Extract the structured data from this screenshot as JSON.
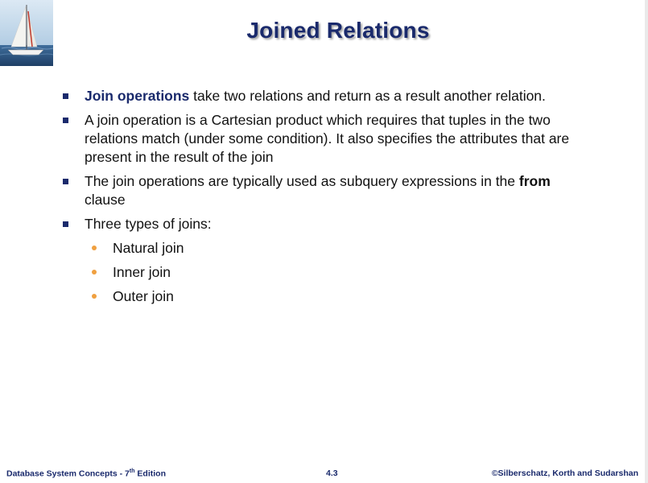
{
  "slide": {
    "title": "Joined Relations",
    "bullets": [
      {
        "lead": "Join operations",
        "text": " take two relations and return as a result another relation."
      },
      {
        "text": "A join operation is a Cartesian product which requires that tuples in the two relations match (under some condition).  It also specifies the attributes that are present in the result of the join"
      },
      {
        "text": "The join operations are typically used as subquery expressions in the ",
        "keyword": "from",
        "after": " clause"
      },
      {
        "text": "Three types of joins:",
        "subitems": [
          "Natural join",
          "Inner join",
          "Outer join"
        ]
      }
    ]
  },
  "footer": {
    "book": "Database System Concepts - 7",
    "edition_sup": "th",
    "edition_word": " Edition",
    "page": "4.3",
    "copyright": "©Silberschatz, Korth and Sudarshan"
  },
  "colors": {
    "title": "#1a2a6c",
    "bullet_square": "#1a2a6c",
    "sub_bullet": "#f0a040",
    "logo_water": "#2e5b8a",
    "logo_sky": "#b9d3e8"
  },
  "icons": {
    "logo": "sailboat-logo-icon",
    "bullet": "square-bullet-icon",
    "sub_bullet": "dot-bullet-icon"
  }
}
